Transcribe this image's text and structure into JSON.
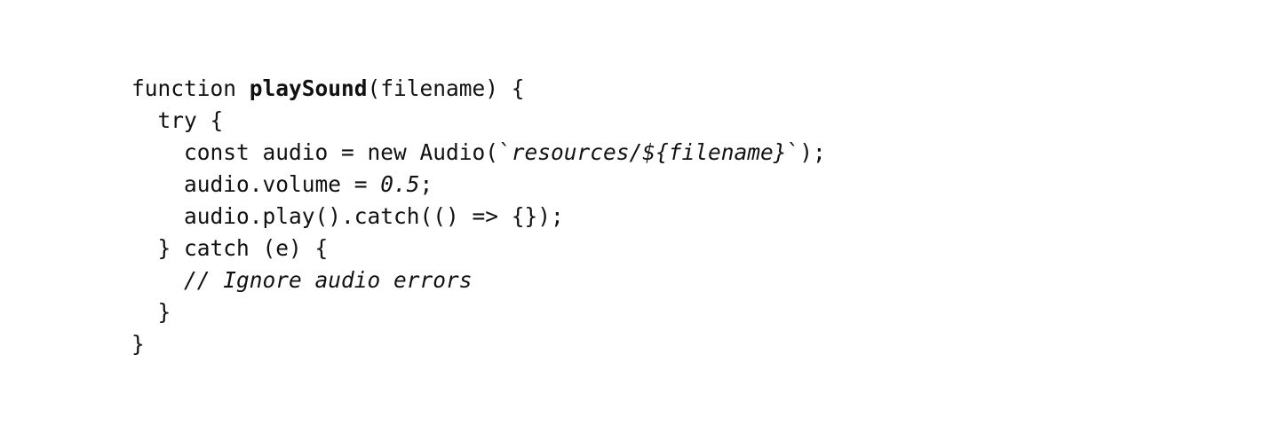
{
  "code": {
    "line1": {
      "keyword": "function ",
      "name": "playSound",
      "rest": "(filename) {"
    },
    "line2": {
      "text": "  try {"
    },
    "line3": {
      "pre": "    const audio = new Audio(`",
      "template": "resources/${filename}",
      "post": "`);"
    },
    "line4": {
      "pre": "    audio.volume = ",
      "number": "0.5",
      "post": ";"
    },
    "line5": {
      "text": "    audio.play().catch(() => {});"
    },
    "line6": {
      "text": "  } catch (e) {"
    },
    "line7": {
      "indent": "    ",
      "comment": "// Ignore audio errors"
    },
    "line8": {
      "text": "  }"
    },
    "line9": {
      "text": "}"
    }
  }
}
